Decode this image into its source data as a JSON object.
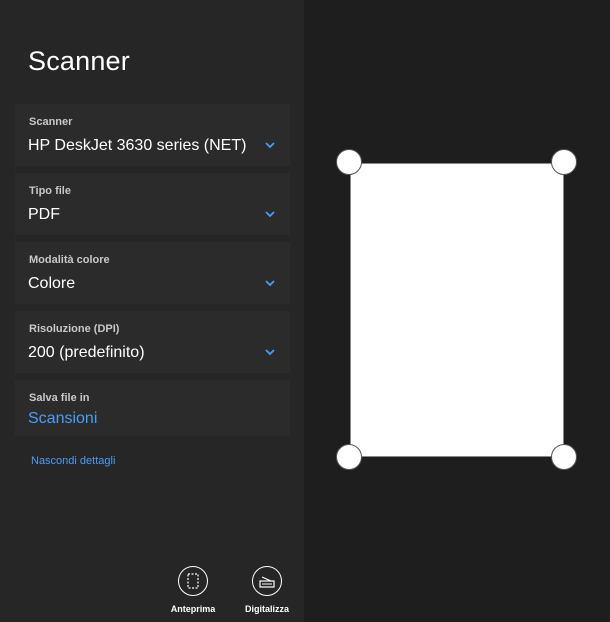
{
  "app": {
    "title": "Scanner"
  },
  "fields": {
    "scanner": {
      "label": "Scanner",
      "value": "HP DeskJet 3630 series (NET)"
    },
    "file_type": {
      "label": "Tipo file",
      "value": "PDF"
    },
    "color_mode": {
      "label": "Modalità colore",
      "value": "Colore"
    },
    "resolution": {
      "label": "Risoluzione (DPI)",
      "value": "200 (predefinito)"
    },
    "save_in": {
      "label": "Salva file in",
      "value": "Scansioni"
    }
  },
  "details_link": "Nascondi dettagli",
  "actions": {
    "preview_label": "Anteprima",
    "scan_label": "Digitalizza"
  },
  "colors": {
    "accent": "#4a9df8",
    "panel_bg": "#262626",
    "field_bg": "#2b2b2b",
    "preview_bg": "#1e1e1e"
  },
  "icons": {
    "dropdown": "chevron-down-icon",
    "preview": "preview-page-icon",
    "scan": "scanner-icon",
    "crop": "crop-handle"
  }
}
